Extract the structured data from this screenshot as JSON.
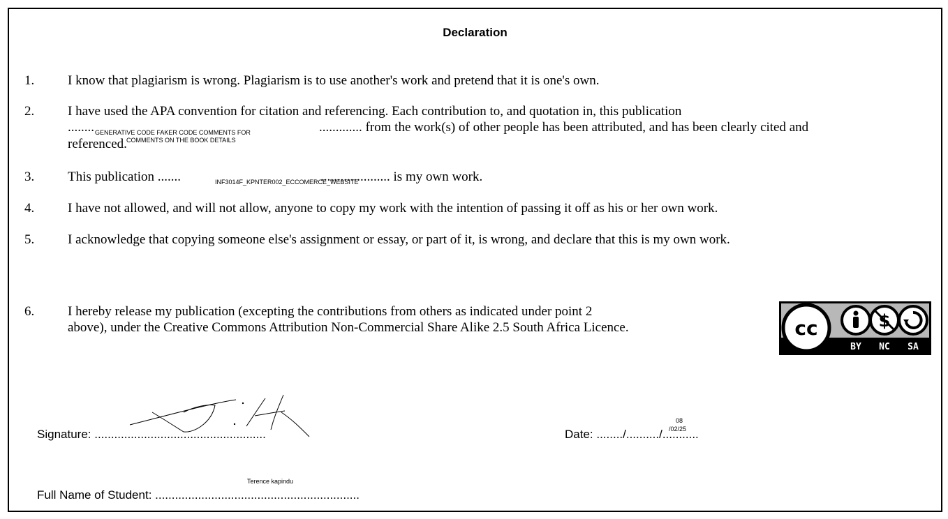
{
  "title": "Declaration",
  "items": [
    {
      "num": "1.",
      "text": "I know that plagiarism is wrong. Plagiarism is to use another's work and pretend that it is one's own."
    },
    {
      "num": "2.",
      "line1": "I have used the APA convention for citation and referencing. Each contribution to, and quotation in, this publication",
      "line2_pre": "........",
      "line2_post": "............. from the work(s) of other people has been attributed, and has been clearly cited and",
      "fill_a": "GENERATIVE CODE FAKER CODE COMMENTS FOR",
      "fill_b": "COMMENTS ON THE BOOK DETAILS",
      "line3": "referenced."
    },
    {
      "num": "3.",
      "pre": "This publication .......",
      "fill": "INF3014F_KPNTER002_ECCOMERCE_WEBSITE",
      "post": "..................... is my own work."
    },
    {
      "num": "4.",
      "text": "I have not allowed, and will not allow, anyone to copy my work with the intention of passing it off as his or her own work."
    },
    {
      "num": "5.",
      "text": "I acknowledge that copying someone else's assignment or essay, or part of it, is wrong, and declare that this is my own work."
    },
    {
      "num": "6.",
      "line1": "I hereby release my publication (excepting the contributions from others as indicated under point 2",
      "line2": "above), under the Creative Commons Attribution Non-Commercial Share Alike 2.5 South Africa Licence."
    }
  ],
  "license_badge": {
    "cc": "cc",
    "by": "BY",
    "nc": "NC",
    "sa": "SA"
  },
  "signature": {
    "label": "Signature: ...................................................."
  },
  "date": {
    "label": "Date: ......../........../...........",
    "day_fill": "08",
    "date_fill": "/02/25"
  },
  "student": {
    "label": "Full Name of Student: ..............................................................",
    "name": "Terence kapindu"
  }
}
